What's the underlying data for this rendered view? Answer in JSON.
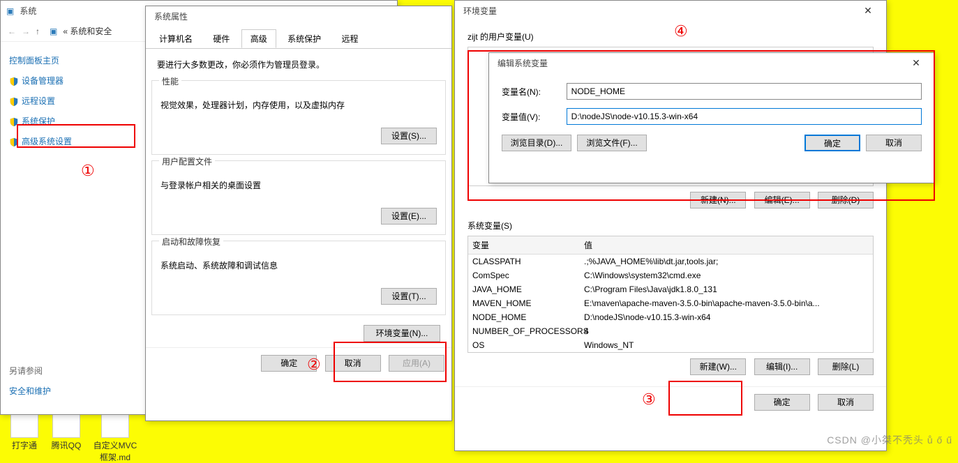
{
  "cp_window": {
    "title": "系统",
    "breadcrumb_root": "系统和安全",
    "side_title": "控制面板主页",
    "links": [
      "设备管理器",
      "远程设置",
      "系统保护",
      "高级系统设置"
    ],
    "see_also_title": "另请参阅",
    "see_also": "安全和维护"
  },
  "sysprop": {
    "title": "系统属性",
    "tabs": [
      "计算机名",
      "硬件",
      "高级",
      "系统保护",
      "远程"
    ],
    "intro": "要进行大多数更改，你必须作为管理员登录。",
    "perf_title": "性能",
    "perf_desc": "视觉效果，处理器计划，内存使用，以及虚拟内存",
    "profiles_title": "用户配置文件",
    "profiles_desc": "与登录帐户相关的桌面设置",
    "startup_title": "启动和故障恢复",
    "startup_desc": "系统启动、系统故障和调试信息",
    "btn_settings_s": "设置(S)...",
    "btn_settings_e": "设置(E)...",
    "btn_settings_t": "设置(T)...",
    "btn_env": "环境变量(N)...",
    "btn_ok": "确定",
    "btn_cancel": "取消",
    "btn_apply": "应用(A)"
  },
  "env": {
    "title": "环境变量",
    "user_title": "zijt 的用户变量(U)",
    "sys_title": "系统变量(S)",
    "hdr_var": "变量",
    "hdr_val": "值",
    "btn_new_n": "新建(N)...",
    "btn_edit_e": "编辑(E)...",
    "btn_del_d": "删除(D)",
    "btn_new_w": "新建(W)...",
    "btn_edit_i": "编辑(I)...",
    "btn_del_l": "删除(L)",
    "btn_ok": "确定",
    "btn_cancel": "取消",
    "sys_vars": [
      {
        "n": "CLASSPATH",
        "v": ".;%JAVA_HOME%\\lib\\dt.jar,tools.jar;"
      },
      {
        "n": "ComSpec",
        "v": "C:\\Windows\\system32\\cmd.exe"
      },
      {
        "n": "JAVA_HOME",
        "v": "C:\\Program Files\\Java\\jdk1.8.0_131"
      },
      {
        "n": "MAVEN_HOME",
        "v": "E:\\maven\\apache-maven-3.5.0-bin\\apache-maven-3.5.0-bin\\a..."
      },
      {
        "n": "NODE_HOME",
        "v": "D:\\nodeJS\\node-v10.15.3-win-x64"
      },
      {
        "n": "NUMBER_OF_PROCESSORS",
        "v": "4"
      },
      {
        "n": "OS",
        "v": "Windows_NT"
      }
    ]
  },
  "edit": {
    "title": "编辑系统变量",
    "name_label": "变量名(N):",
    "value_label": "变量值(V):",
    "name_value": "NODE_HOME",
    "value_value": "D:\\nodeJS\\node-v10.15.3-win-x64",
    "btn_browse_dir": "浏览目录(D)...",
    "btn_browse_file": "浏览文件(F)...",
    "btn_ok": "确定",
    "btn_cancel": "取消"
  },
  "desktop": {
    "typing": "打字通",
    "qq": "腾讯QQ",
    "mvc": "自定义MVC框架.md"
  },
  "markers": {
    "m1": "①",
    "m2": "②",
    "m3": "③",
    "m4": "④"
  },
  "watermark": "CSDN @小桀不秃头 ů ő ű"
}
